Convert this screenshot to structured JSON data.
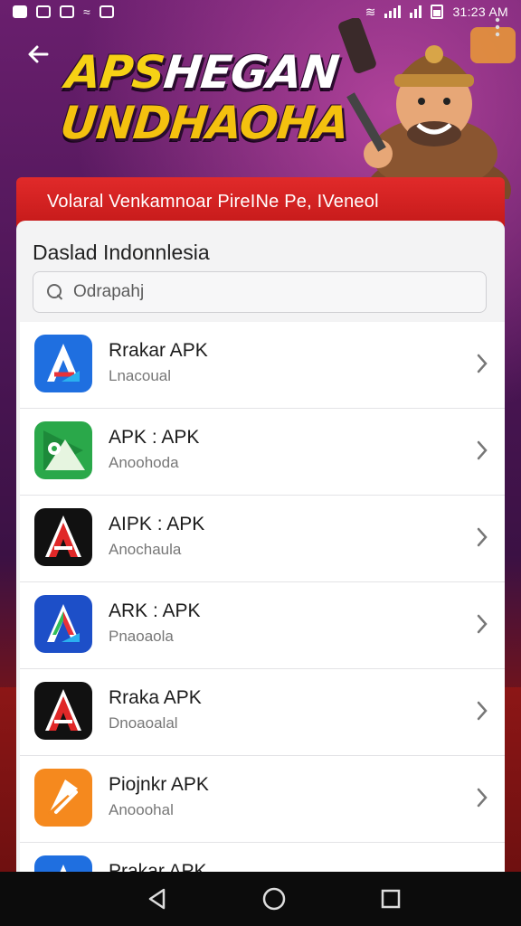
{
  "status_bar": {
    "time": "31:23 AM"
  },
  "header": {
    "hero_line1_a": "APS",
    "hero_line1_b": "HEGAN",
    "hero_line2": "UNDHAOHA"
  },
  "banner": {
    "text": "Volaral Venkamnoar PireINe Pe, IVeneol"
  },
  "card": {
    "title": "Daslad Indonnlesia",
    "search_placeholder": "Odrapahj"
  },
  "apps": [
    {
      "name": "Rrakar APK",
      "sub": "Lnacoual",
      "icon": "a-blue-icon"
    },
    {
      "name": "APK : APK",
      "sub": "Anoohoda",
      "icon": "green-play-icon"
    },
    {
      "name": "AIPK : APK",
      "sub": "Anochaula",
      "icon": "a-red-black-icon"
    },
    {
      "name": "ARK : APK",
      "sub": "Pnaoaola",
      "icon": "a-blue-dark-icon"
    },
    {
      "name": "Rraka APK",
      "sub": "Dnoaoalal",
      "icon": "a-red-black-icon"
    },
    {
      "name": "Piojnkr APK",
      "sub": "Anooohal",
      "icon": "orange-p-icon"
    },
    {
      "name": "Prakar APK",
      "sub": "",
      "icon": "a-blue-icon"
    }
  ],
  "colors": {
    "banner_red": "#d82222",
    "hero_yellow": "#f6d215",
    "card_bg": "#f3f3f4"
  }
}
